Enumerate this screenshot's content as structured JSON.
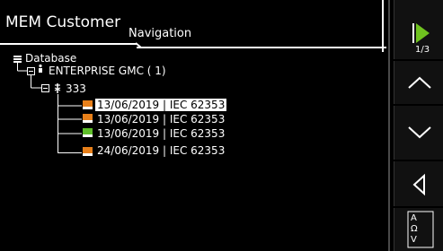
{
  "header": {
    "title": "MEM Customer",
    "subtitle": "Navigation"
  },
  "tree": {
    "root": {
      "label": "Database",
      "icon": "database-icon"
    },
    "customer": {
      "label": "ENTERPRISE GMC ( 1)",
      "icon": "person-icon"
    },
    "site": {
      "label": "333",
      "icon": "site-icon"
    },
    "records": [
      {
        "label": "13/06/2019 | IEC 62353",
        "status": "orange",
        "selected": true
      },
      {
        "label": "13/06/2019 | IEC 62353",
        "status": "orange",
        "selected": false
      },
      {
        "label": "13/06/2019 | IEC 62353",
        "status": "green",
        "selected": false
      },
      {
        "label": "24/06/2019 | IEC 62353",
        "status": "orange",
        "selected": false
      }
    ]
  },
  "sidebar": {
    "page": "1/3",
    "keyboard_letters": [
      "A",
      "Ω",
      "V"
    ]
  },
  "colors": {
    "background": "#000000",
    "accent_green": "#6fc21f",
    "status_orange": "#e8801a",
    "status_green": "#5fbf2a"
  }
}
